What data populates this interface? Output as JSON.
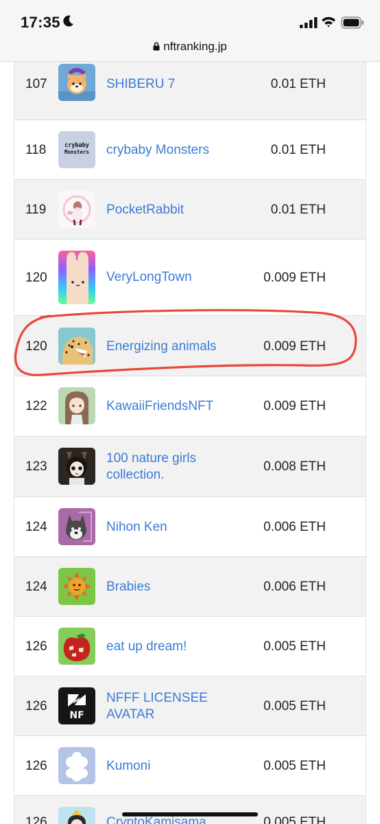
{
  "status_bar": {
    "time": "17:35"
  },
  "browser": {
    "url": "nftranking.jp"
  },
  "rows": [
    {
      "rank": "107",
      "name": "SHIBERU 7",
      "price": "0.01 ETH",
      "icon": "shiba-dog-icon"
    },
    {
      "rank": "118",
      "name": "crybaby Monsters",
      "price": "0.01 ETH",
      "icon": "crybaby-monsters-logo-icon",
      "logo_text": "crybaby Monsters"
    },
    {
      "rank": "119",
      "name": "PocketRabbit",
      "price": "0.01 ETH",
      "icon": "pocket-rabbit-icon"
    },
    {
      "rank": "120",
      "name": "VeryLongTown",
      "price": "0.009 ETH",
      "icon": "long-rabbit-icon"
    },
    {
      "rank": "120",
      "name": "Energizing animals",
      "price": "0.009 ETH",
      "icon": "cheetah-icon"
    },
    {
      "rank": "122",
      "name": "KawaiiFriendsNFT",
      "price": "0.009 ETH",
      "icon": "kawaii-girl-icon"
    },
    {
      "rank": "123",
      "name": "100 nature girls collection.",
      "price": "0.008 ETH",
      "icon": "nature-girl-icon"
    },
    {
      "rank": "124",
      "name": "Nihon Ken",
      "price": "0.006 ETH",
      "icon": "nihon-ken-dog-icon"
    },
    {
      "rank": "124",
      "name": "Brabies",
      "price": "0.006 ETH",
      "icon": "sun-creature-icon"
    },
    {
      "rank": "126",
      "name": "eat up dream!",
      "price": "0.005 ETH",
      "icon": "apple-icon"
    },
    {
      "rank": "126",
      "name": "NFFF LICENSEE AVATAR",
      "price": "0.005 ETH",
      "icon": "nf-logo-icon",
      "logo_text": "NF"
    },
    {
      "rank": "126",
      "name": "Kumoni",
      "price": "0.005 ETH",
      "icon": "cloud-creature-icon"
    },
    {
      "rank": "126",
      "name": "CryptoKamisama",
      "price": "0.005 ETH",
      "icon": "kamisama-icon"
    }
  ],
  "annotation": {
    "color": "#e8473b",
    "highlighted_row": "Energizing animals"
  }
}
